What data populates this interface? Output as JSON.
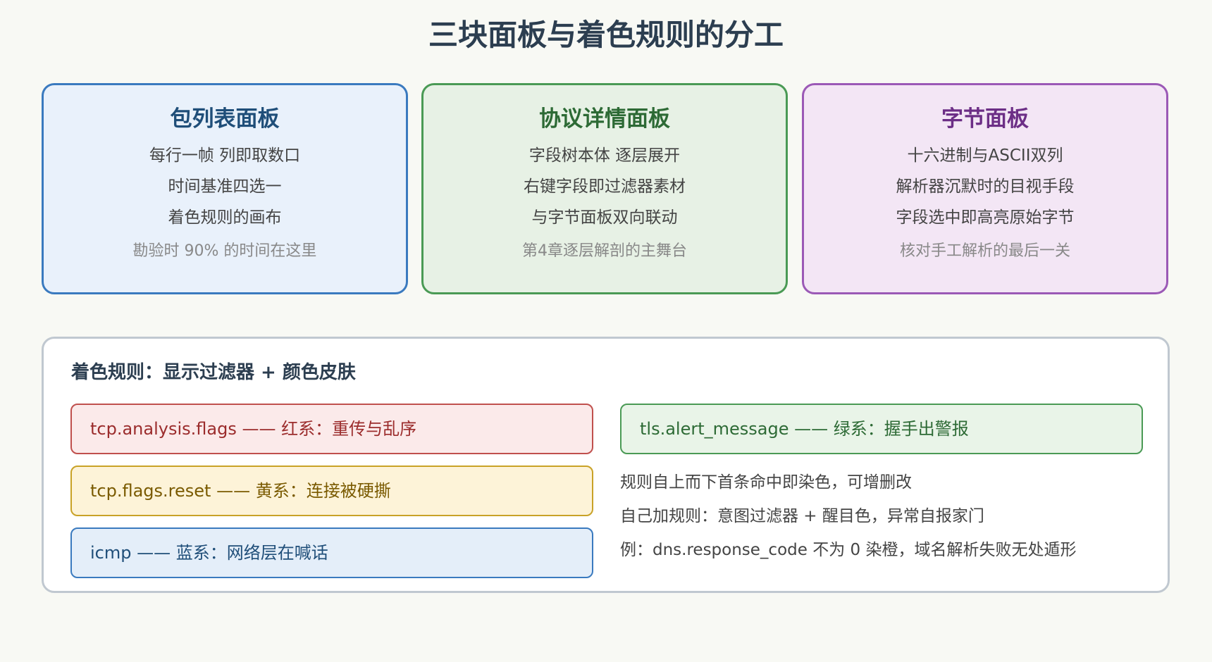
{
  "title": "三块面板与着色规则的分工",
  "panels": [
    {
      "title": "包列表面板",
      "lines": [
        "每行一帧 列即取数口",
        "时间基准四选一",
        "着色规则的画布"
      ],
      "note": "勘验时 90% 的时间在这里"
    },
    {
      "title": "协议详情面板",
      "lines": [
        "字段树本体 逐层展开",
        "右键字段即过滤器素材",
        "与字节面板双向联动"
      ],
      "note": "第4章逐层解剖的主舞台"
    },
    {
      "title": "字节面板",
      "lines": [
        "十六进制与ASCII双列",
        "解析器沉默时的目视手段",
        "字段选中即高亮原始字节"
      ],
      "note": "核对手工解析的最后一关"
    }
  ],
  "rules": {
    "title": "着色规则：显示过滤器 + 颜色皮肤",
    "items": [
      {
        "text": "tcp.analysis.flags —— 红系：重传与乱序",
        "color": "#c0504d"
      },
      {
        "text": "tcp.flags.reset —— 黄系：连接被硬撕",
        "color": "#c9a227"
      },
      {
        "text": "icmp —— 蓝系：网络层在喊话",
        "color": "#3a7abf"
      },
      {
        "text": "tls.alert_message —— 绿系：握手出警报",
        "color": "#4a9a55"
      }
    ],
    "notes": [
      "规则自上而下首条命中即染色，可增删改",
      "自己加规则：意图过滤器 + 醒目色，异常自报家门",
      "例：dns.response_code 不为 0 染橙，域名解析失败无处遁形"
    ]
  }
}
